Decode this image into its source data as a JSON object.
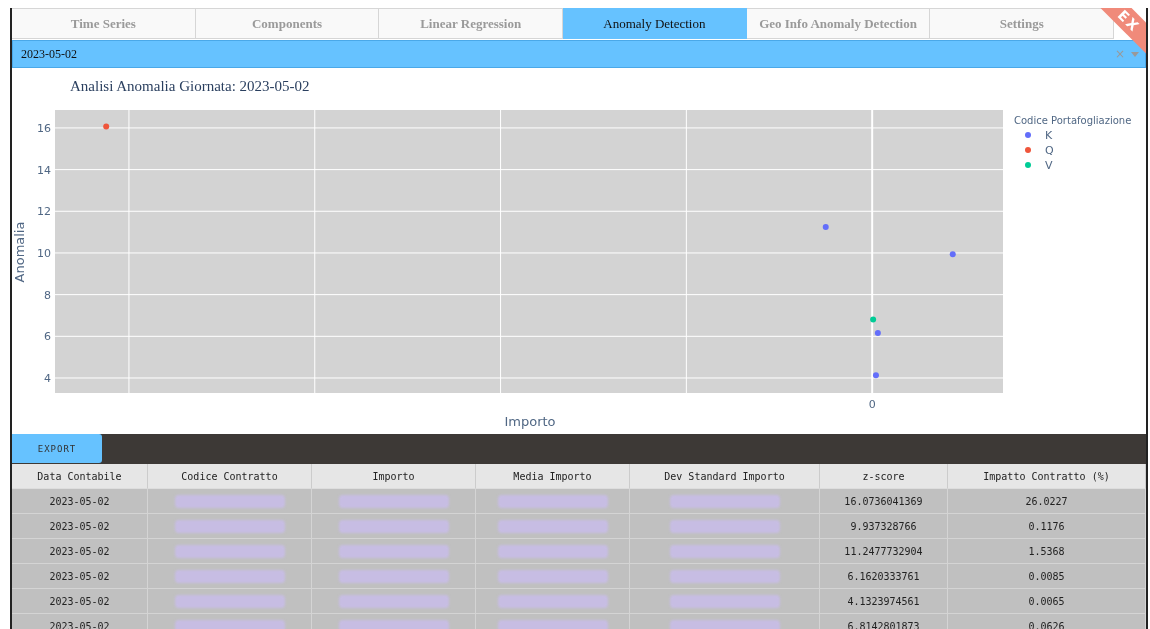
{
  "tabs": [
    {
      "label": "Time Series",
      "selected": false
    },
    {
      "label": "Components",
      "selected": false
    },
    {
      "label": "Linear Regression",
      "selected": false
    },
    {
      "label": "Anomaly Detection",
      "selected": true
    },
    {
      "label": "Geo Info Anomaly Detection",
      "selected": false
    },
    {
      "label": "Settings",
      "selected": false
    }
  ],
  "ribbon": {
    "text": "EX"
  },
  "date_dropdown": {
    "value": "2023-05-02",
    "clear_icon": "×"
  },
  "chart": {
    "title": "Analisi Anomalia Giornata: 2023-05-02",
    "xlabel": "Importo",
    "ylabel": "Anomalia",
    "y_tick_labels": [
      "16",
      "14",
      "12",
      "10",
      "8",
      "6",
      "4"
    ],
    "x_tick_label": "0",
    "legend": {
      "title": "Codice Portafogliazione",
      "items": [
        {
          "name": "K",
          "color": "#636efa"
        },
        {
          "name": "Q",
          "color": "#ef553b"
        },
        {
          "name": "V",
          "color": "#00cc96"
        }
      ]
    }
  },
  "export_button": {
    "label": "EXPORT"
  },
  "table": {
    "columns": [
      "Data Contabile",
      "Codice Contratto",
      "Importo",
      "Media Importo",
      "Dev Standard Importo",
      "z-score",
      "Impatto Contratto (%)"
    ],
    "rows": [
      [
        "2023-05-02",
        null,
        null,
        null,
        null,
        "16.0736041369",
        "26.0227"
      ],
      [
        "2023-05-02",
        null,
        null,
        null,
        null,
        "9.937328766",
        "0.1176"
      ],
      [
        "2023-05-02",
        null,
        null,
        null,
        null,
        "11.2477732904",
        "1.5368"
      ],
      [
        "2023-05-02",
        null,
        null,
        null,
        null,
        "6.1620333761",
        "0.0085"
      ],
      [
        "2023-05-02",
        null,
        null,
        null,
        null,
        "4.1323974561",
        "0.0065"
      ],
      [
        "2023-05-02",
        null,
        null,
        null,
        null,
        "6.8142801873",
        "0.0626"
      ]
    ]
  }
}
